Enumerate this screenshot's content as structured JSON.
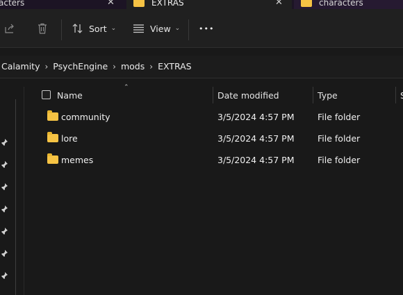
{
  "tabs": [
    {
      "label": "acters",
      "close": "✕"
    },
    {
      "label": "EXTRAS",
      "close": "✕"
    },
    {
      "label": "characters"
    }
  ],
  "toolbar": {
    "sort_label": "Sort",
    "view_label": "View",
    "more_label": "•••"
  },
  "breadcrumb": [
    "Calamity",
    "PsychEngine",
    "mods",
    "EXTRAS"
  ],
  "columns": {
    "name": "Name",
    "date": "Date modified",
    "type": "Type",
    "size": "S"
  },
  "files": [
    {
      "name": "community",
      "date": "3/5/2024 4:57 PM",
      "type": "File folder"
    },
    {
      "name": "lore",
      "date": "3/5/2024 4:57 PM",
      "type": "File folder"
    },
    {
      "name": "memes",
      "date": "3/5/2024 4:57 PM",
      "type": "File folder"
    }
  ],
  "colors": {
    "background": "#191919",
    "folder": "#f6c344",
    "tab_strip": "#1c1424"
  },
  "icons": [
    "folder-icon",
    "close-icon",
    "share-icon",
    "delete-icon",
    "sort-icon",
    "view-icon",
    "chevron-down-icon",
    "chevron-right-icon",
    "pin-icon",
    "checkbox-icon"
  ]
}
